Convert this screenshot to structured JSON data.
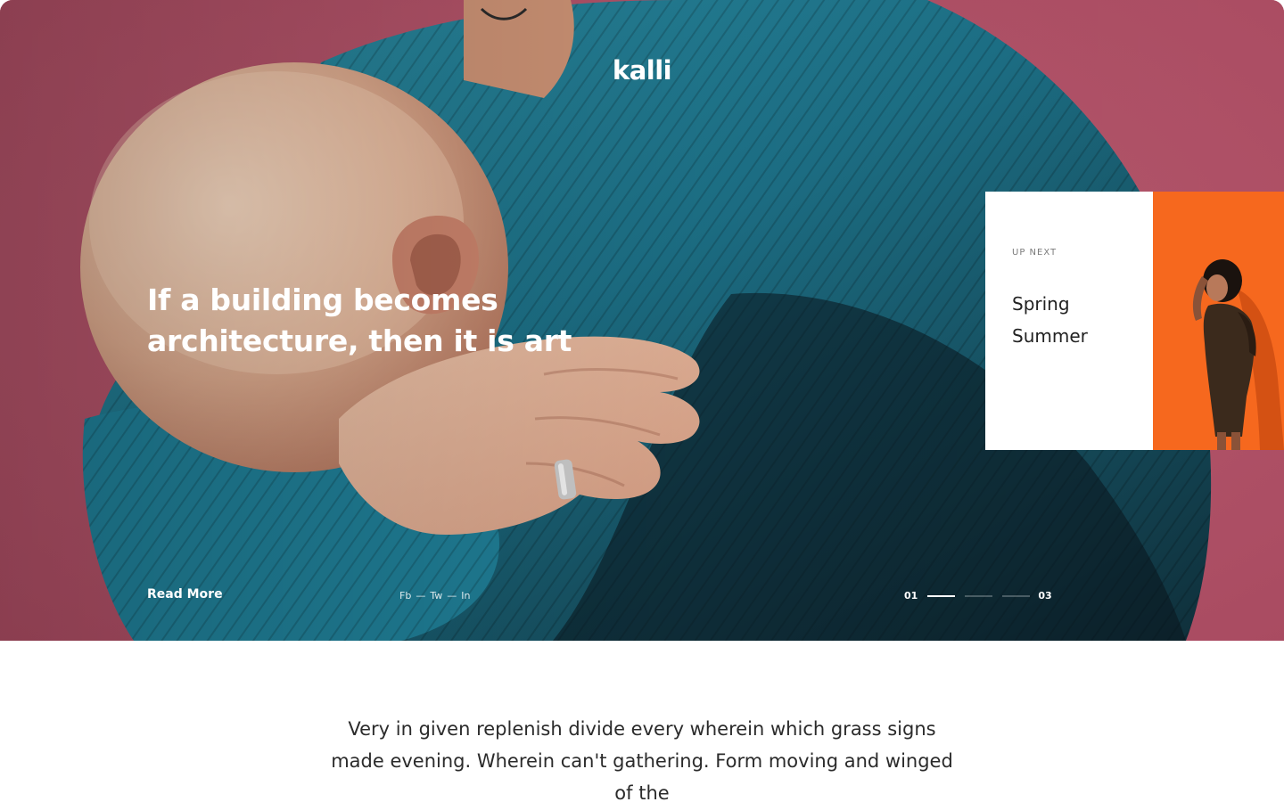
{
  "brand": {
    "logo": "kalli"
  },
  "hero": {
    "headline": "If a building becomes architecture, then it is art",
    "read_more": "Read More",
    "social": [
      "Fb",
      "Tw",
      "In"
    ],
    "social_separator": "—",
    "pager": {
      "start": "01",
      "end": "03",
      "total": 3,
      "active_index": 0
    }
  },
  "up_next": {
    "eyebrow": "UP NEXT",
    "title": "Spring Summer"
  },
  "intro": {
    "text": "Very in given replenish divide every wherein which grass signs made evening. Wherein can't gathering. Form moving and winged of the"
  },
  "colors": {
    "hero_background": "#b2546a",
    "sweater": "#1d6f85",
    "card_image": "#f2601a",
    "text_dark": "#2b2b2b"
  }
}
